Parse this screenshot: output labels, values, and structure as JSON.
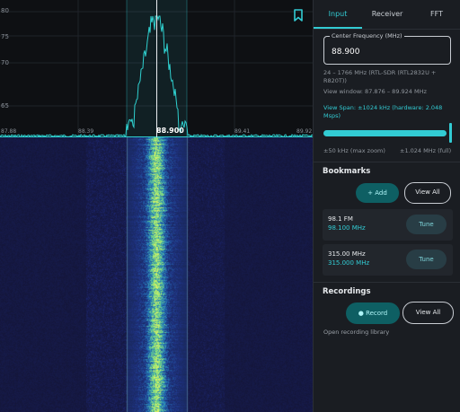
{
  "spectrum": {
    "db_labels": [
      "80",
      "75",
      "70",
      "65"
    ],
    "freq_ticks": [
      "87.88",
      "88.39",
      "89.41",
      "89.92"
    ],
    "center_freq": "88.900"
  },
  "tabs": [
    {
      "label": "Input",
      "active": true
    },
    {
      "label": "Receiver",
      "active": false
    },
    {
      "label": "FFT",
      "active": false
    }
  ],
  "input": {
    "center_frequency_label": "Center Frequency (MHz)",
    "center_frequency_value": "88.900",
    "device_info_line1": "24 – 1766 MHz (RTL-SDR (RTL2832U +",
    "device_info_line2": "R820T))",
    "view_window": "View window: 87.876 – 89.924 MHz",
    "span_label_line1": "View Span: ±1024 kHz  (hardware: 2.048",
    "span_label_line2": "Msps)",
    "span_fraction": 1.0,
    "span_min_label": "±50 kHz (max zoom)",
    "span_max_label": "±1.024 MHz (full)"
  },
  "bookmarks": {
    "title": "Bookmarks",
    "add_label": "+ Add",
    "view_all_label": "View All",
    "items": [
      {
        "name": "98.1 FM",
        "freq": "98.100 MHz",
        "tune_label": "Tune"
      },
      {
        "name": "315.00 MHz",
        "freq": "315.000 MHz",
        "tune_label": "Tune"
      }
    ]
  },
  "recordings": {
    "title": "Recordings",
    "record_label": "● Record",
    "view_all_label": "View All",
    "library_link": "Open recording library"
  },
  "colors": {
    "accent": "#32cbd3",
    "trace": "#2fd0cf",
    "waterfall_peak": "#e9f55a"
  },
  "icons": {
    "bookmark": "bookmark-outline-icon"
  }
}
